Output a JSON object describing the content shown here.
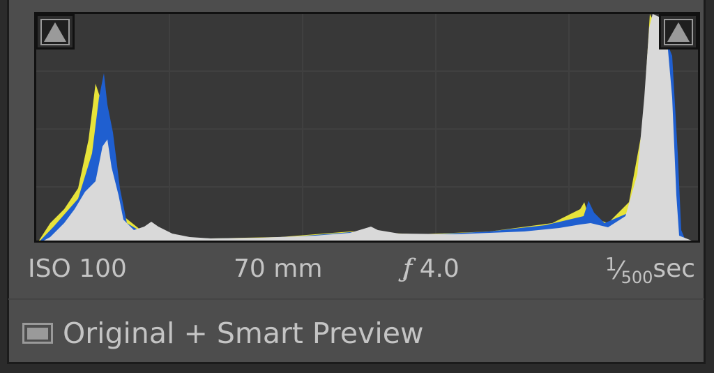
{
  "histogram": {
    "colors": {
      "blue": "#1f5fd0",
      "yellow": "#e7e33a",
      "luminance": "#d9d9d9"
    }
  },
  "camera_info": {
    "iso": "ISO 100",
    "focal_length": "70 mm",
    "aperture_symbol": "ƒ",
    "aperture_value": " / 4.0",
    "shutter_numerator": "1",
    "shutter_denominator": "500",
    "shutter_unit": " sec"
  },
  "preview": {
    "icon": "photo-preview-icon",
    "label": "Original + Smart Preview"
  },
  "icons": {
    "shadow_clipping": "triangle-up-icon",
    "highlight_clipping": "triangle-up-icon"
  }
}
